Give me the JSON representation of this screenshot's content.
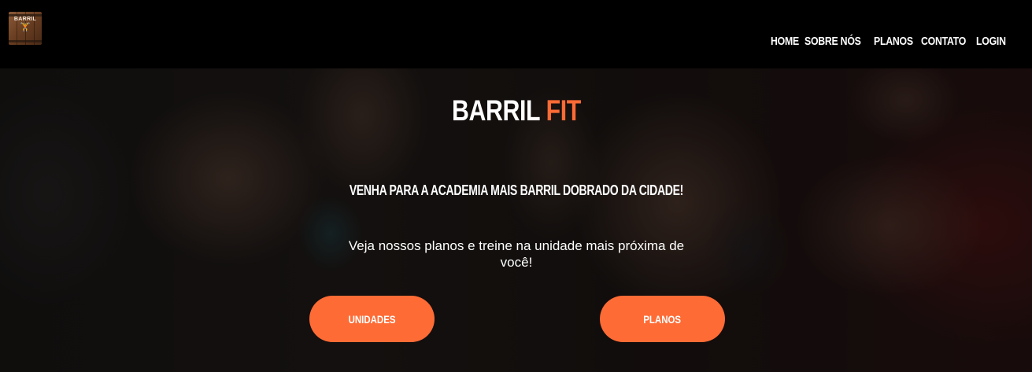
{
  "logo": {
    "text": "BARRIL",
    "figure": "🏋"
  },
  "nav": {
    "items": [
      {
        "label": "HOME"
      },
      {
        "label": "SOBRE NÓS"
      },
      {
        "label": "PLANOS"
      },
      {
        "label": "CONTATO"
      },
      {
        "label": "LOGIN"
      }
    ]
  },
  "hero": {
    "title_main": "BARRIL",
    "title_accent": "FIT",
    "tagline": "VENHA PARA A ACADEMIA MAIS BARRIL DOBRADO DA CIDADE!",
    "description": "Veja nossos planos e treine na unidade mais próxima de você!",
    "buttons": {
      "unidades": "UNIDADES",
      "planos": "PLANOS"
    }
  },
  "colors": {
    "accent": "#ff6b35",
    "navbar_bg": "#000000",
    "text": "#ffffff"
  }
}
